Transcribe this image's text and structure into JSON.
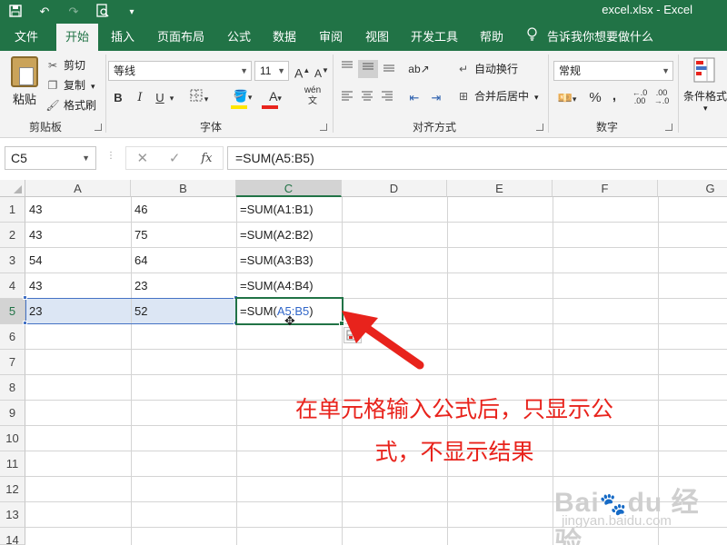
{
  "titlebar": {
    "title": "excel.xlsx - Excel",
    "qat": {
      "save_icon": "save-icon",
      "undo_icon": "undo-icon",
      "redo_icon": "redo-icon",
      "preview_icon": "print-preview-icon",
      "customize_icon": "customize-qat-icon"
    }
  },
  "tabs": [
    {
      "label": "文件"
    },
    {
      "label": "开始"
    },
    {
      "label": "插入"
    },
    {
      "label": "页面布局"
    },
    {
      "label": "公式"
    },
    {
      "label": "数据"
    },
    {
      "label": "审阅"
    },
    {
      "label": "视图"
    },
    {
      "label": "开发工具"
    },
    {
      "label": "帮助"
    }
  ],
  "active_tab": "开始",
  "tellme": {
    "label": "告诉我你想要做什么",
    "icon": "lightbulb-icon"
  },
  "ribbon": {
    "clipboard": {
      "paste": "粘贴",
      "cut": "剪切",
      "copy": "复制",
      "format_painter": "格式刷",
      "group_label": "剪贴板"
    },
    "font": {
      "font_name": "等线",
      "font_size": "11",
      "grow": "A",
      "shrink": "A",
      "bold": "B",
      "italic": "I",
      "underline": "U",
      "phonetic": "wén",
      "group_label": "字体"
    },
    "alignment": {
      "wrap_text": "自动换行",
      "merge_center": "合并后居中",
      "group_label": "对齐方式"
    },
    "number": {
      "format": "常规",
      "percent": "%",
      "comma": ",",
      "group_label": "数字"
    },
    "styles": {
      "conditional_format": "条件格式"
    }
  },
  "formula_bar": {
    "name_box": "C5",
    "formula": "=SUM(A5:B5)",
    "cancel": "✕",
    "enter": "✓",
    "fx": "fx"
  },
  "sheet": {
    "columns": [
      "A",
      "B",
      "C",
      "D",
      "E",
      "F",
      "G"
    ],
    "rows": [
      "1",
      "2",
      "3",
      "4",
      "5",
      "6",
      "7",
      "8",
      "9",
      "10",
      "11",
      "12",
      "13",
      "14"
    ],
    "selected_column": "C",
    "selected_row": "5",
    "cells": [
      [
        "43",
        "46",
        "=SUM(A1:B1)"
      ],
      [
        "43",
        "75",
        "=SUM(A2:B2)"
      ],
      [
        "54",
        "64",
        "=SUM(A3:B3)"
      ],
      [
        "43",
        "23",
        "=SUM(A4:B4)"
      ],
      [
        "23",
        "52",
        "=SUM("
      ]
    ],
    "editing_ref": "A5:B5",
    "editing_suffix": ")"
  },
  "annotation": {
    "line1": "在单元格输入公式后，只显示公",
    "line2": "式，不显示结果",
    "color": "#e8231c"
  },
  "watermark": {
    "logo": "Bai du 经验",
    "url": "jingyan.baidu.com"
  },
  "colors": {
    "brand": "#217346",
    "selection": "#dce6f4",
    "ref_blue": "#4472c4"
  }
}
